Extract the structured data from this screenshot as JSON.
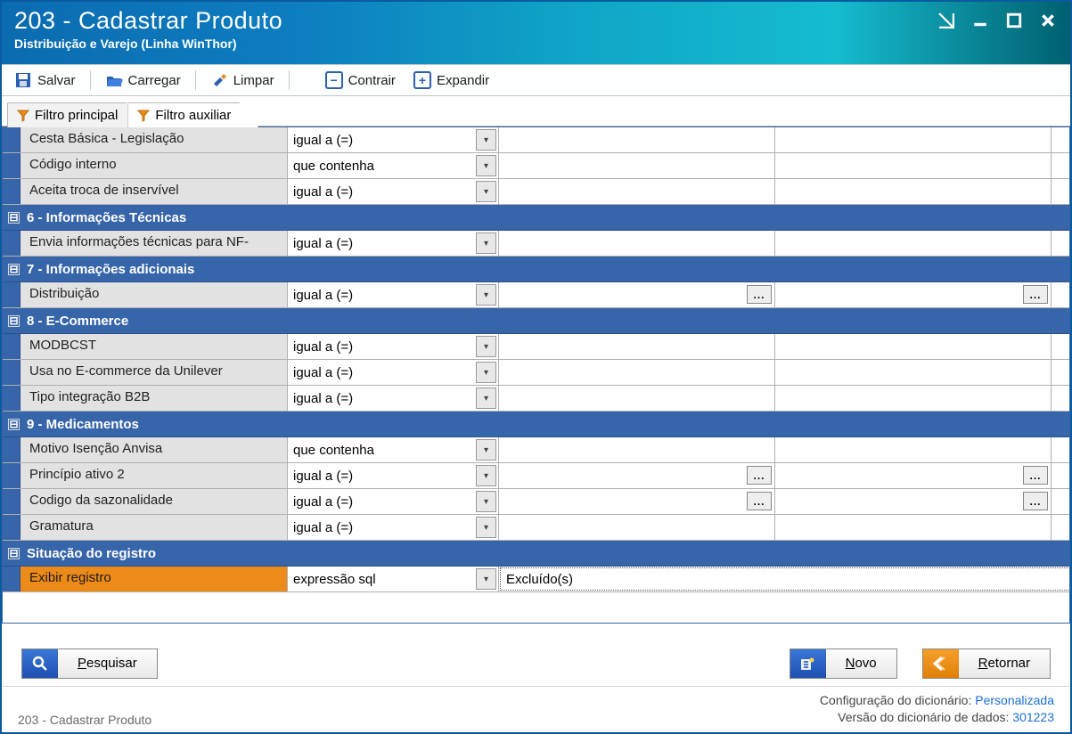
{
  "header": {
    "title": "203 - Cadastrar  Produto",
    "subtitle": "Distribuição e Varejo (Linha WinThor)"
  },
  "toolbar": {
    "save": "Salvar",
    "load": "Carregar",
    "clear": "Limpar",
    "collapse": "Contrair",
    "expand": "Expandir"
  },
  "tabs": {
    "main": "Filtro principal",
    "aux": "Filtro auxiliar"
  },
  "ops": {
    "eq": "igual a (=)",
    "contains": "que contenha",
    "sql": "expressão sql"
  },
  "rows": {
    "cesta": "Cesta Básica - Legislação",
    "codint": "Código interno",
    "aceita": "Aceita troca de inservível",
    "envianf": "Envia informações técnicas para NF-",
    "distrib": "Distribuição",
    "modbcst": "MODBCST",
    "usaecom": "Usa no E-commerce da Unilever",
    "tipob2b": "Tipo integração B2B",
    "motivoanv": "Motivo Isenção Anvisa",
    "princat2": "Princípio ativo 2",
    "codsaz": "Codigo da sazonalidade",
    "gramat": "Gramatura",
    "exibreg": "Exibir registro"
  },
  "groups": {
    "g6": "6 - Informações Técnicas",
    "g7": "7 - Informações adicionais",
    "g8": "8 - E-Commerce",
    "g9": "9 - Medicamentos",
    "gsit": "Situação do registro"
  },
  "values": {
    "excluidos": "Excluído(s)"
  },
  "buttons": {
    "search": "Pesquisar",
    "new": "Novo",
    "return": "Retornar"
  },
  "status": {
    "left": "203 - Cadastrar  Produto",
    "cfg_lab": "Configuração do dicionário:",
    "cfg_val": "Personalizada",
    "ver_lab": "Versão do dicionário de dados:",
    "ver_val": "301223"
  }
}
